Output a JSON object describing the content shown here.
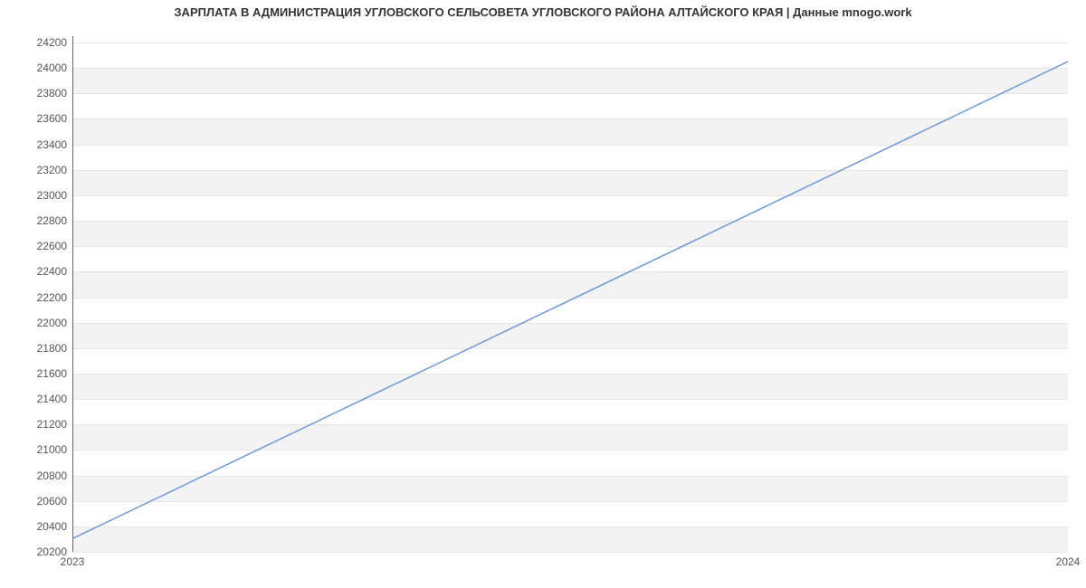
{
  "chart_data": {
    "type": "line",
    "title": "ЗАРПЛАТА В АДМИНИСТРАЦИЯ УГЛОВСКОГО СЕЛЬСОВЕТА УГЛОВСКОГО РАЙОНА АЛТАЙСКОГО КРАЯ | Данные mnogo.work",
    "x": [
      2023,
      2024
    ],
    "values": [
      20300,
      24050
    ],
    "x_ticks": [
      2023,
      2024
    ],
    "y_ticks": [
      20200,
      20400,
      20600,
      20800,
      21000,
      21200,
      21400,
      21600,
      21800,
      22000,
      22200,
      22400,
      22600,
      22800,
      23000,
      23200,
      23400,
      23600,
      23800,
      24000,
      24200
    ],
    "xlim": [
      2023,
      2024
    ],
    "ylim": [
      20200,
      24250
    ],
    "xlabel": "",
    "ylabel": "",
    "line_color": "#6f99d9",
    "band_color": "#f3f3f3",
    "grid": true
  }
}
